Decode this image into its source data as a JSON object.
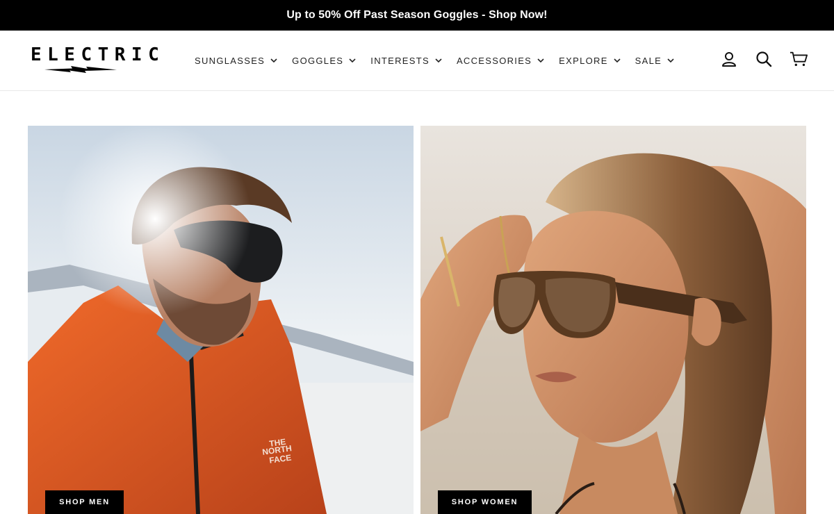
{
  "announcement": {
    "text": "Up to 50% Off Past Season Goggles - Shop Now!"
  },
  "brand": {
    "logo_text": "ELECTRIC"
  },
  "nav": {
    "items": [
      {
        "label": "SUNGLASSES",
        "icon": "chevron-down-icon"
      },
      {
        "label": "GOGGLES",
        "icon": "chevron-down-icon"
      },
      {
        "label": "INTERESTS",
        "icon": "chevron-down-icon"
      },
      {
        "label": "ACCESSORIES",
        "icon": "chevron-down-icon"
      },
      {
        "label": "EXPLORE",
        "icon": "chevron-down-icon"
      },
      {
        "label": "SALE",
        "icon": "chevron-down-icon"
      }
    ]
  },
  "header_icons": [
    "account-icon",
    "search-icon",
    "cart-icon"
  ],
  "hero": {
    "men": {
      "button_label": "SHOP MEN"
    },
    "women": {
      "button_label": "SHOP WOMEN"
    }
  },
  "colors": {
    "announcement_bg": "#000000",
    "button_bg": "#000000",
    "button_text": "#ffffff"
  }
}
